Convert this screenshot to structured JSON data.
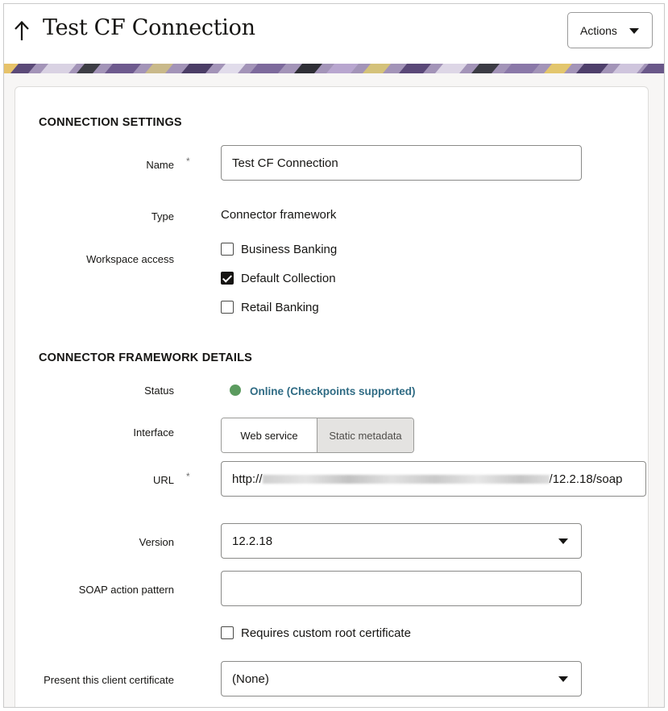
{
  "header": {
    "title": "Test CF Connection",
    "actions_label": "Actions"
  },
  "connection_settings": {
    "section_title": "CONNECTION SETTINGS",
    "name_label": "Name",
    "name_required_mark": "*",
    "name_value": "Test CF Connection",
    "type_label": "Type",
    "type_value": "Connector framework",
    "workspace_label": "Workspace access",
    "workspaces": [
      {
        "label": "Business Banking",
        "checked": false
      },
      {
        "label": "Default Collection",
        "checked": true
      },
      {
        "label": "Retail Banking",
        "checked": false
      }
    ]
  },
  "connector_details": {
    "section_title": "CONNECTOR FRAMEWORK DETAILS",
    "status_label": "Status",
    "status_value": "Online (Checkpoints supported)",
    "status_color": "#5b9b5f",
    "interface_label": "Interface",
    "interface_options": [
      "Web service",
      "Static metadata"
    ],
    "interface_selected": "Web service",
    "url_label": "URL",
    "url_required_mark": "*",
    "url_prefix": "http://",
    "url_suffix": "/12.2.18/soap",
    "version_label": "Version",
    "version_value": "12.2.18",
    "soap_label": "SOAP action pattern",
    "soap_value": "",
    "custom_root_label": "Requires custom root certificate",
    "custom_root_checked": false,
    "client_cert_label": "Present this client certificate",
    "client_cert_value": "(None)"
  }
}
